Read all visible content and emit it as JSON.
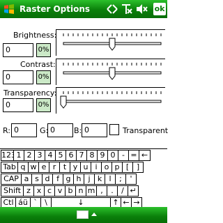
{
  "title": "Raster Options",
  "ok_label": "ok",
  "fields": [
    {
      "label": "Brightness:",
      "value": "0",
      "pct": "0%",
      "level": 0.5
    },
    {
      "label": "Contrast:",
      "value": "0",
      "pct": "0%",
      "level": 0.5
    },
    {
      "label": "Transparency:",
      "value": "0",
      "pct": "0%",
      "level": 0.0
    }
  ],
  "rgb": {
    "r_label": "R:",
    "g_label": "G:",
    "b_label": "B:",
    "r": "0",
    "g": "0",
    "b": "0"
  },
  "transparent_label": "Transparent",
  "keyboard": {
    "row1": [
      "123",
      "1",
      "2",
      "3",
      "4",
      "5",
      "6",
      "7",
      "8",
      "9",
      "0",
      "-",
      "=",
      "←"
    ],
    "row2": [
      "Tab",
      "q",
      "w",
      "e",
      "r",
      "t",
      "y",
      "u",
      "i",
      "o",
      "p",
      "[",
      "]"
    ],
    "row3": [
      "CAP",
      "a",
      "s",
      "d",
      "f",
      "g",
      "h",
      "j",
      "k",
      "l",
      ";",
      "'"
    ],
    "row4": [
      "Shift",
      "z",
      "x",
      "c",
      "v",
      "b",
      "n",
      "m",
      ",",
      ".",
      "/",
      "↵"
    ],
    "row5": [
      "Ctl",
      "áü",
      "`",
      "\\",
      "↓",
      "↑",
      "←",
      "→"
    ]
  },
  "colors": {
    "title_bar": "#0a7f0a",
    "pct_bg": "#cbe9c7"
  }
}
